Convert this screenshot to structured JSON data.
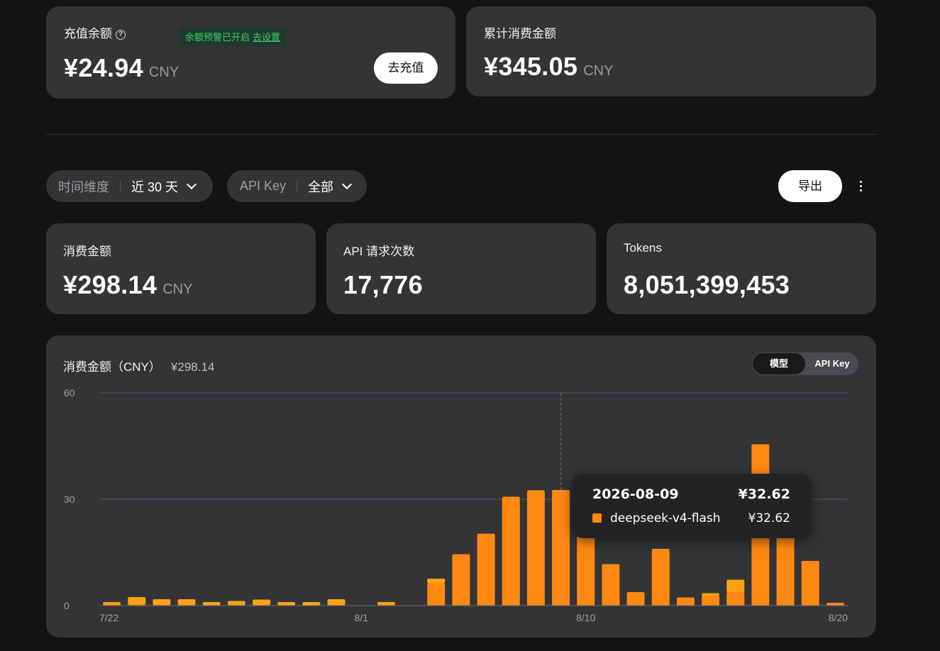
{
  "balance": {
    "label": "充值余额",
    "help_icon": "?",
    "alert_text": "余额预警已开启",
    "alert_link": "去设置",
    "amount": "¥24.94",
    "unit": "CNY",
    "topup_button": "去充值"
  },
  "total_spent": {
    "label": "累计消费金额",
    "amount": "¥345.05",
    "unit": "CNY"
  },
  "filters": {
    "time_label": "时间维度",
    "time_value": "近 30 天",
    "apikey_label": "API Key",
    "apikey_value": "全部",
    "export_button": "导出",
    "more_icon": "more-vertical-icon"
  },
  "stats": {
    "spend": {
      "label": "消费金额",
      "value": "¥298.14",
      "unit": "CNY"
    },
    "requests": {
      "label": "API 请求次数",
      "value": "17,776"
    },
    "tokens": {
      "label": "Tokens",
      "value": "8,051,399,453"
    }
  },
  "chart_panel": {
    "title": "消费金额（CNY）",
    "total": "¥298.14",
    "toggle": [
      "模型",
      "API Key"
    ],
    "active_toggle": "模型"
  },
  "tooltip": {
    "date": "2026-08-09",
    "total": "¥32.62",
    "series_name": "deepseek-v4-flash",
    "series_value": "¥32.62"
  },
  "colors": {
    "primary_bar": "#ff8811",
    "secondary_bar": "#ffa114",
    "card_bg": "#333436",
    "page_bg": "#131315",
    "alert_green": "#3ecf6b"
  },
  "chart_data": {
    "type": "bar",
    "stacked": true,
    "categories": [
      "7/22",
      "7/23",
      "7/24",
      "7/25",
      "7/26",
      "7/27",
      "7/28",
      "7/29",
      "7/30",
      "7/31",
      "8/1",
      "8/2",
      "8/3",
      "8/4",
      "8/5",
      "8/6",
      "8/7",
      "8/8",
      "8/9",
      "8/10",
      "8/11",
      "8/12",
      "8/13",
      "8/14",
      "8/15",
      "8/16",
      "8/17",
      "8/18",
      "8/19",
      "8/20"
    ],
    "x_tick_labels": [
      "7/22",
      "8/1",
      "8/10",
      "8/20"
    ],
    "series": [
      {
        "name": "deepseek-v4-flash",
        "values": [
          0.2,
          0.3,
          0.2,
          0.2,
          0.1,
          0.2,
          0.2,
          0.1,
          0.1,
          0.2,
          0,
          0.2,
          0,
          6.3,
          14.5,
          20.3,
          30.5,
          32.2,
          32.62,
          28.3,
          11.7,
          3.8,
          15.7,
          2.3,
          2.8,
          3.8,
          45.5,
          31.0,
          12.6,
          0.8
        ]
      },
      {
        "values": [
          0.8,
          2.1,
          1.6,
          1.6,
          0.9,
          1.1,
          1.5,
          0.9,
          0.9,
          1.6,
          0,
          0.8,
          0,
          1.3,
          0,
          0,
          0.2,
          0.3,
          0,
          0,
          0,
          0,
          0.3,
          0,
          0.7,
          3.5,
          0,
          0,
          0,
          0
        ]
      }
    ],
    "ylim": [
      0,
      60
    ],
    "yticks": [
      0,
      30,
      60
    ],
    "grid": true,
    "highlight_category": "8/9"
  }
}
